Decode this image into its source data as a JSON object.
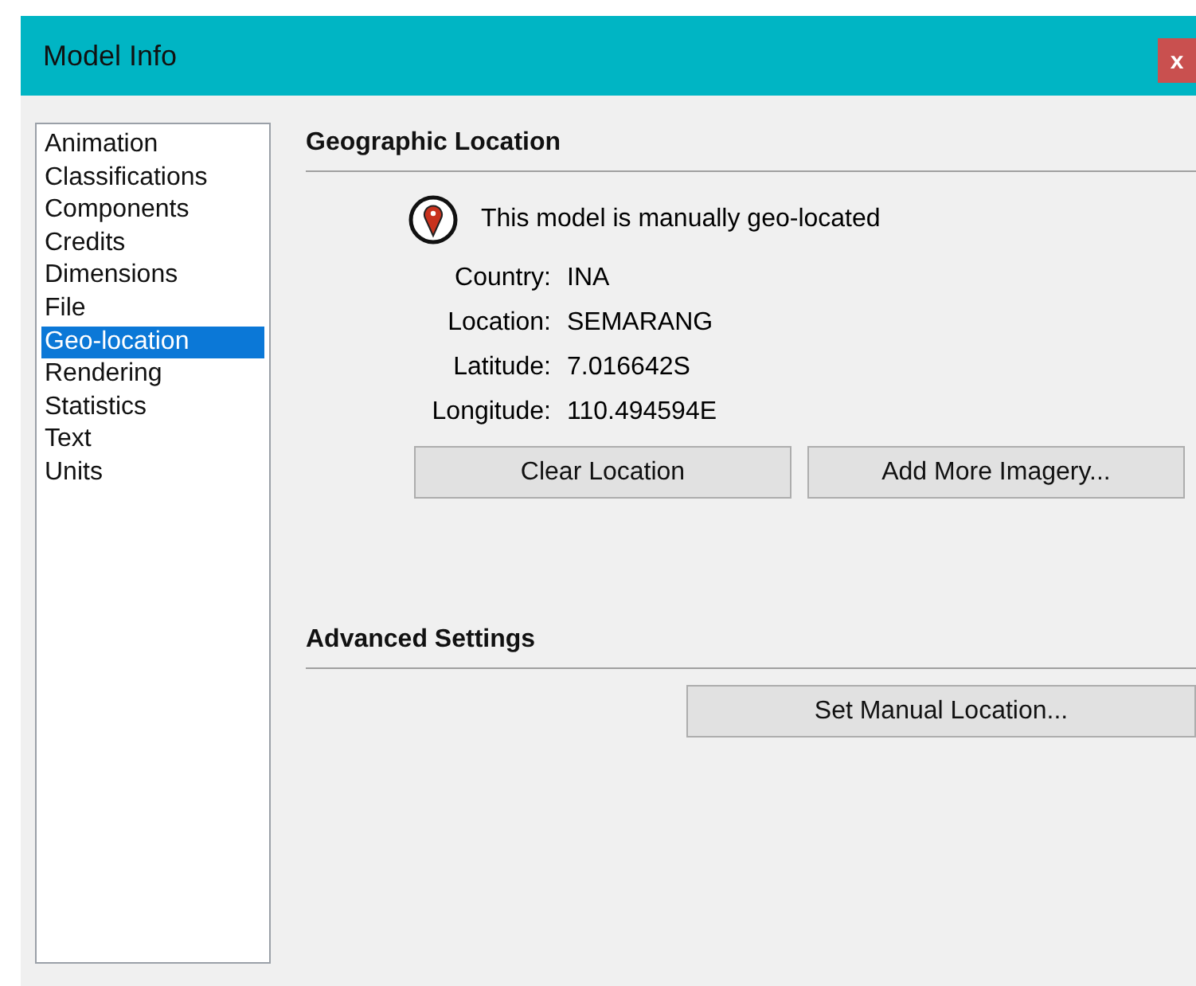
{
  "window": {
    "title": "Model Info",
    "close": "x"
  },
  "sidebar": {
    "items": [
      {
        "label": "Animation",
        "selected": false
      },
      {
        "label": "Classifications",
        "selected": false
      },
      {
        "label": "Components",
        "selected": false
      },
      {
        "label": "Credits",
        "selected": false
      },
      {
        "label": "Dimensions",
        "selected": false
      },
      {
        "label": "File",
        "selected": false
      },
      {
        "label": "Geo-location",
        "selected": true
      },
      {
        "label": "Rendering",
        "selected": false
      },
      {
        "label": "Statistics",
        "selected": false
      },
      {
        "label": "Text",
        "selected": false
      },
      {
        "label": "Units",
        "selected": false
      }
    ]
  },
  "geographic_location": {
    "heading": "Geographic Location",
    "status": "This model is manually geo-located",
    "fields": [
      {
        "label": "Country:",
        "value": "INA"
      },
      {
        "label": "Location:",
        "value": "SEMARANG"
      },
      {
        "label": "Latitude:",
        "value": "7.016642S"
      },
      {
        "label": "Longitude:",
        "value": "110.494594E"
      }
    ],
    "buttons": [
      "Clear Location",
      "Add More Imagery..."
    ]
  },
  "advanced_settings": {
    "heading": "Advanced Settings",
    "buttons": [
      "Set Manual Location..."
    ]
  }
}
